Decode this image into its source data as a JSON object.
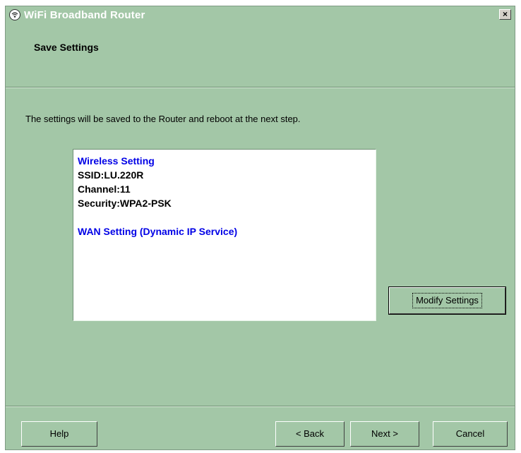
{
  "window": {
    "title": "WiFi Broadband Router",
    "close_label": "×",
    "icon": "router-wifi-icon"
  },
  "header": {
    "title": "Save Settings"
  },
  "body": {
    "info_text": "The settings will be saved to the Router and reboot at the next step.",
    "summary": {
      "wireless_heading": "Wireless Setting",
      "ssid": "SSID:LU.220R",
      "channel": "Channel:11",
      "security": "Security:WPA2-PSK",
      "wan_heading": "WAN Setting  (Dynamic IP Service)"
    },
    "modify_button": "Modify Settings"
  },
  "footer": {
    "help": "Help",
    "back": "< Back",
    "next": "Next >",
    "cancel": "Cancel"
  },
  "colors": {
    "background": "#a3c7a7",
    "heading_blue": "#0000e6"
  }
}
